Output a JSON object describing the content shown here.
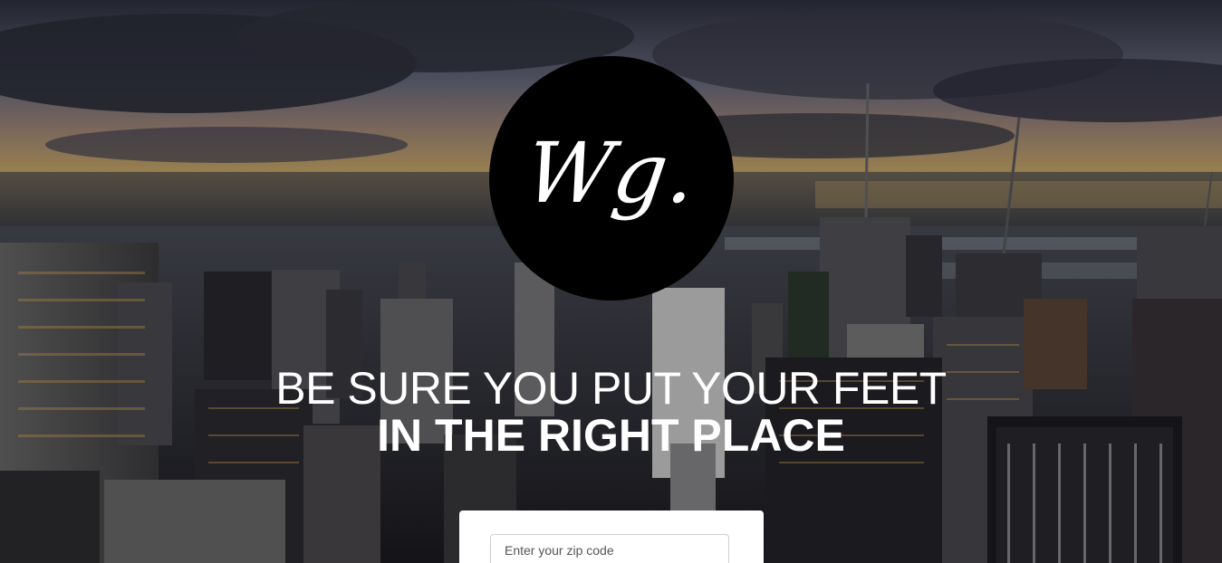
{
  "logo": {
    "text": "Wg."
  },
  "headline": {
    "line1": "BE SURE YOU PUT YOUR FEET",
    "line2": "IN THE RIGHT PLACE"
  },
  "search": {
    "placeholder": "Enter your zip code"
  },
  "background": {
    "description_icon": "city-skyline-image"
  }
}
